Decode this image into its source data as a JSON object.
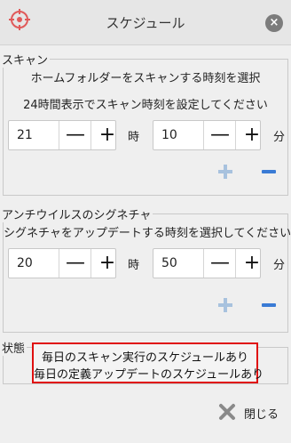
{
  "window": {
    "title": "スケジュール",
    "close_icon": "×"
  },
  "scan": {
    "section_label": "スキャン",
    "line1": "ホームフォルダーをスキャンする時刻を選択",
    "line2": "24時間表示でスキャン時刻を設定してください",
    "hour": "21",
    "minute": "10",
    "hour_unit": "時",
    "minute_unit": "分"
  },
  "signature": {
    "section_label": "アンチウイルスのシグネチャ",
    "line1": "シグネチャをアップデートする時刻を選択してください",
    "hour": "20",
    "minute": "50",
    "hour_unit": "時",
    "minute_unit": "分"
  },
  "status": {
    "section_label": "状態",
    "line1": "毎日のスキャン実行のスケジュールあり",
    "line2": "毎日の定義アップデートのスケジュールあり"
  },
  "spin_symbols": {
    "minus": "—",
    "plus": "+"
  },
  "footer": {
    "close_label": "閉じる"
  },
  "colors": {
    "accent_blue": "#3a7bd5",
    "plus_light": "#a8c2de",
    "highlight_red": "#e01010"
  }
}
